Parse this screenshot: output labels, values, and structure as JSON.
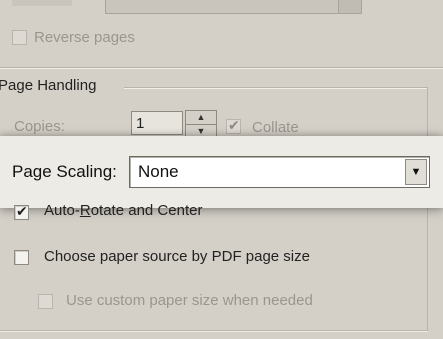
{
  "reverse_pages": {
    "label": "Reverse pages",
    "checked": false,
    "enabled": false
  },
  "page_handling": {
    "title": "Page Handling",
    "copies_label": "Copies:",
    "copies_value": "1",
    "collate_label": "Collate",
    "collate_checked": true,
    "page_scaling_label": "Page Scaling:",
    "page_scaling_value": "None",
    "auto_rotate_prefix": "Auto-",
    "auto_rotate_accel": "R",
    "auto_rotate_suffix": "otate and Center",
    "auto_rotate_checked": true,
    "choose_source_label": "Choose paper source by PDF page size",
    "choose_source_checked": false,
    "custom_size_label": "Use custom paper size when needed",
    "custom_size_checked": false
  },
  "icons": {
    "check": "✔",
    "spin_up": "▲",
    "spin_down": "▼",
    "dropdown": "▼"
  }
}
